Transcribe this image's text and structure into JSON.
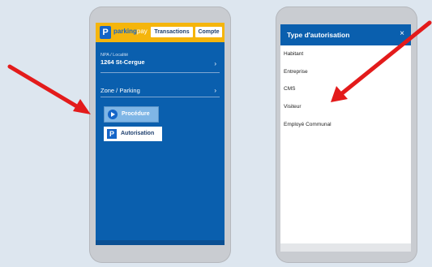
{
  "left_screen": {
    "brand_primary": "parking",
    "brand_secondary": "pay",
    "logo_letter": "P",
    "tabs": [
      "Transactions",
      "Compte"
    ],
    "npa_label": "NPA / Localité",
    "npa_value": "1264 St-Cergue",
    "zone_label": "Zone / Parking",
    "procedure_button": "Procédure",
    "authorization_button": "Autorisation",
    "parking_icon_letter": "P",
    "chevron": "›"
  },
  "right_screen": {
    "header_title": "Type d'autorisation",
    "close_symbol": "×",
    "options": [
      "Habitant",
      "Entreprise",
      "CMS",
      "Visiteur",
      "Employé Communal"
    ]
  },
  "colors": {
    "background": "#dde6ef",
    "app_blue": "#0a5fae",
    "topbar_yellow": "#f5b50c",
    "arrow_red": "#e31b1b"
  }
}
